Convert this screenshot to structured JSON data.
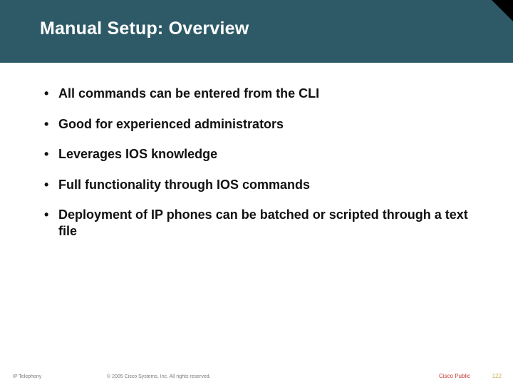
{
  "title": "Manual Setup: Overview",
  "bullets": [
    "All commands can be entered from the CLI",
    "Good for experienced administrators",
    "Leverages IOS knowledge",
    "Full functionality through IOS commands",
    "Deployment of IP phones can be batched or scripted through a text file"
  ],
  "footer": {
    "course": "IP Telephony",
    "copyright": "© 2005 Cisco Systems, Inc. All rights reserved.",
    "classification": "Cisco Public",
    "page_number": "122"
  }
}
